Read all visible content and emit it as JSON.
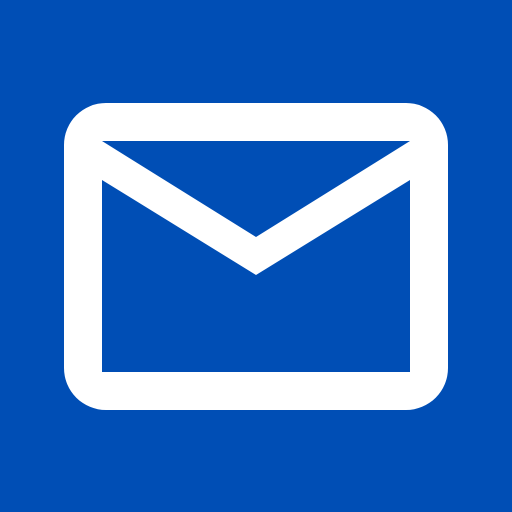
{
  "app_icon": {
    "icon_name": "mail-envelope-icon",
    "background_color": "#004EB5",
    "glyph_color": "#FFFFFF"
  }
}
